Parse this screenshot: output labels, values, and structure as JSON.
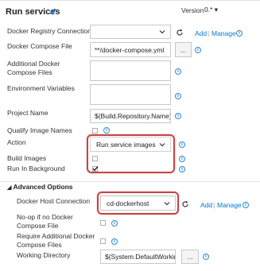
{
  "header": {
    "title": "Run services",
    "version_label": "Version",
    "version_value": "0.*",
    "version_arrow": "▾"
  },
  "links": {
    "add": "Add",
    "separator": "|",
    "manage": "Manage"
  },
  "fields": {
    "registry_connection": {
      "label": "Docker Registry Connection",
      "value": ""
    },
    "compose_file": {
      "label": "Docker Compose File",
      "value": "**/docker-compose.yml",
      "browse": "..."
    },
    "additional_compose": {
      "label": "Additional Docker Compose Files",
      "value": ""
    },
    "env_vars": {
      "label": "Environment Variables",
      "value": ""
    },
    "project_name": {
      "label": "Project Name",
      "value": "$(Build.Repository.Name)"
    },
    "qualify_image_names": {
      "label": "Qualify Image Names",
      "checked": false
    },
    "action": {
      "label": "Action",
      "value": "Run service images"
    },
    "build_images": {
      "label": "Build Images",
      "checked": false
    },
    "run_in_background": {
      "label": "Run In Background",
      "checked": true
    }
  },
  "advanced": {
    "header": "Advanced Options",
    "docker_host": {
      "label": "Docker Host Connection",
      "value": "cd-dockerhost"
    },
    "noop": {
      "label": "No-op if no Docker Compose File",
      "checked": false
    },
    "require_additional": {
      "label": "Require Additional Docker Compose Files",
      "checked": false
    },
    "working_dir": {
      "label": "Working Directory",
      "value": "$(System.DefaultWorking",
      "browse": "..."
    }
  }
}
